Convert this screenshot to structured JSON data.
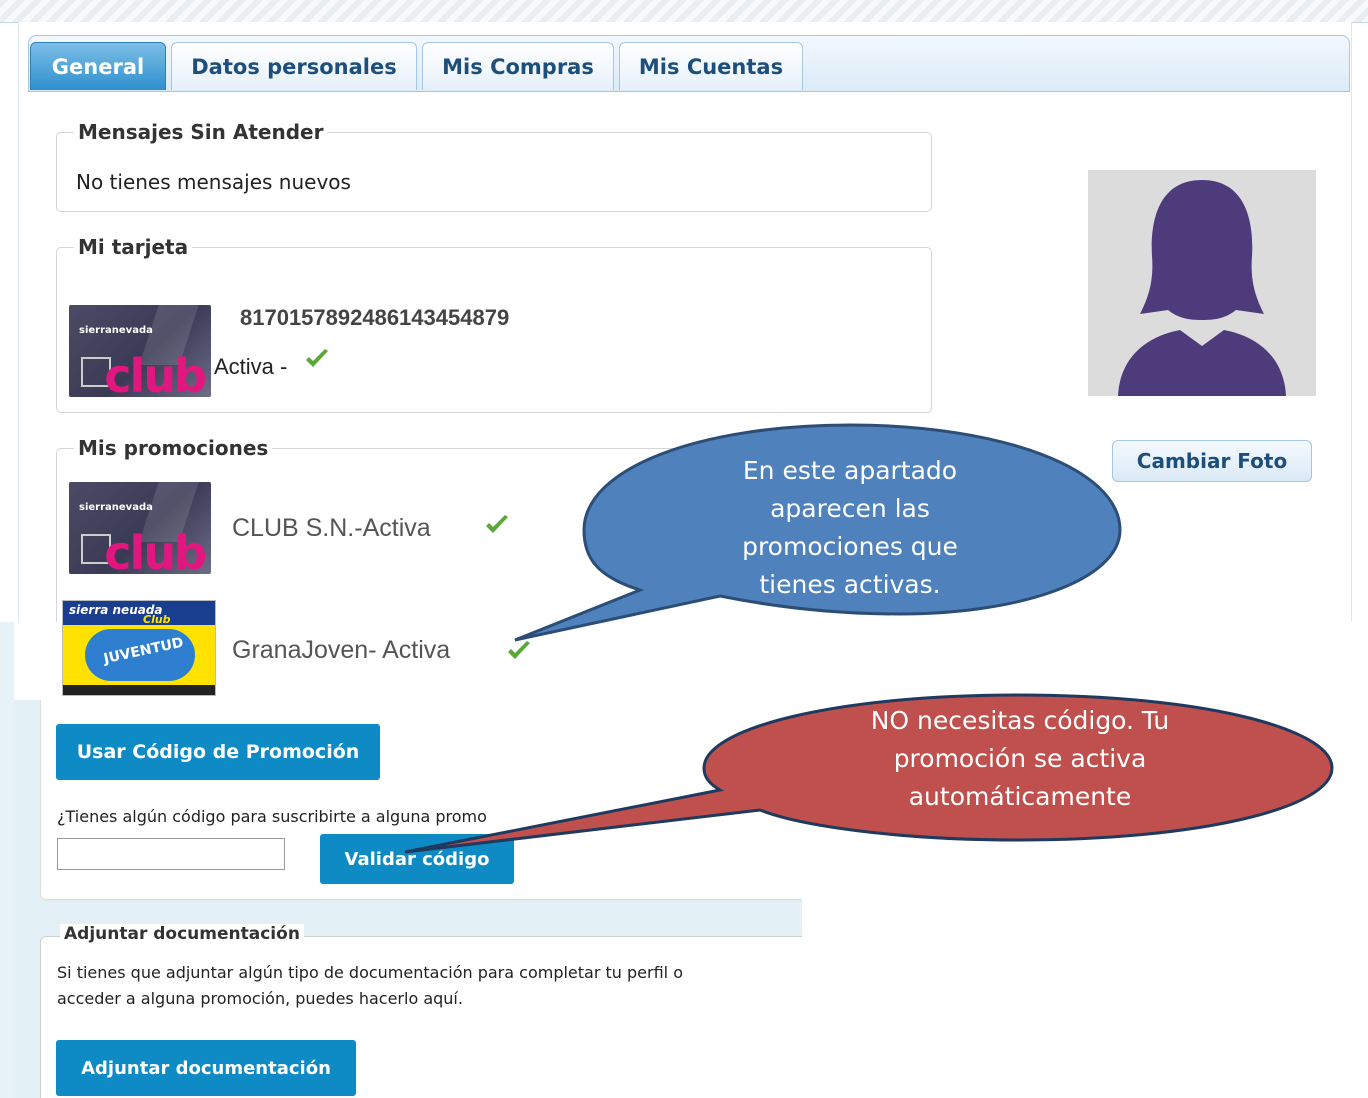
{
  "tabs": [
    {
      "label": "General",
      "active": true
    },
    {
      "label": "Datos personales",
      "active": false
    },
    {
      "label": "Mis Compras",
      "active": false
    },
    {
      "label": "Mis Cuentas",
      "active": false
    }
  ],
  "messages": {
    "legend": "Mensajes Sin Atender",
    "text": "No tienes mensajes nuevos"
  },
  "card": {
    "legend": "Mi tarjeta",
    "number": "8170157892486143454879",
    "status": "Activa -",
    "image_text": "club",
    "image_brand": "sierranevada"
  },
  "promotions": {
    "legend": "Mis promociones",
    "items": [
      {
        "label": "CLUB S.N.-Activa",
        "image_text": "club"
      },
      {
        "label": "GranaJoven- Activa",
        "image_title": "sierra neuada",
        "image_sub": "Club",
        "image_juv": "JUVENTUD"
      }
    ]
  },
  "promo_code": {
    "button_label": "Usar Código de Promoción",
    "question": "¿Tienes algún código para suscribirte a alguna promo",
    "input_value": "",
    "validate_label": "Validar código"
  },
  "documentation": {
    "legend": "Adjuntar documentación",
    "description_line1": "Si tienes que adjuntar algún tipo de documentación para completar tu perfil o",
    "description_line2": "acceder a alguna promoción, puedes hacerlo aquí.",
    "button_label": "Adjuntar documentación"
  },
  "profile": {
    "change_photo_label": "Cambiar Foto"
  },
  "callouts": {
    "blue": [
      "En este apartado",
      "aparecen las",
      "promociones que",
      "tienes activas."
    ],
    "red": [
      "NO necesitas código. Tu",
      "promoción se activa",
      "automáticamente"
    ]
  },
  "colors": {
    "accent_blue": "#0e8bc4",
    "check_green": "#5aa83a",
    "callout_blue": "#4f81bd",
    "callout_red": "#c0504d",
    "avatar_purple": "#4e3b7c"
  }
}
